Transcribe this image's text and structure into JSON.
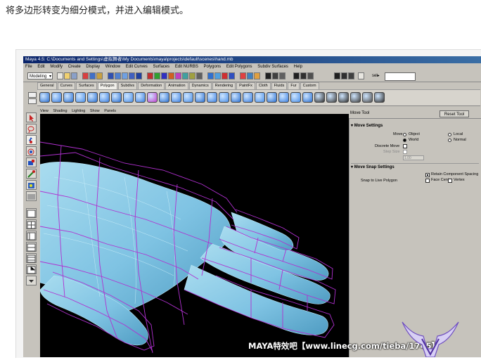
{
  "caption": "将多边形转变为细分模式，并进入编辑模式。",
  "window": {
    "title": "Maya 4.5: C:\\Documents and Settings\\虚拟舞者\\My Documents\\maya\\projects\\default\\scenes\\hand.mb"
  },
  "menubar": [
    "File",
    "Edit",
    "Modify",
    "Create",
    "Display",
    "Window",
    "Edit Curves",
    "Surfaces",
    "Edit NURBS",
    "Polygons",
    "Edit Polygons",
    "Subdiv Surfaces",
    "Help"
  ],
  "statusline": {
    "mode": "Modeling",
    "sel_label": "sel▸",
    "sel_value": ""
  },
  "shelf_tabs": {
    "items": [
      "General",
      "Curves",
      "Surfaces",
      "Polygon",
      "Subdivs",
      "Deformation",
      "Animation",
      "Dynamics",
      "Rendering",
      "PaintFx",
      "Cloth",
      "Fluids",
      "Fur",
      "Custom"
    ],
    "active_index": 3
  },
  "panel_menu": [
    "View",
    "Shading",
    "Lighting",
    "Show",
    "Panels"
  ],
  "tool_settings": {
    "title": "Move Tool",
    "reset_button": "Reset Tool",
    "move_settings": {
      "header": "Move Settings",
      "move_label": "Move",
      "options": [
        "Object",
        "Local",
        "World",
        "Normal"
      ],
      "selected": "World",
      "discrete_move_label": "Discrete Move",
      "step_size_label": "Step Size",
      "step_size_value": "1.00"
    },
    "snap_settings": {
      "header": "Move Snap Settings",
      "retain_label": "Retain Component Spacing",
      "retain_checked": true,
      "snap_live_label": "Snap to Live Polygon",
      "face_center_label": "Face Center",
      "vertex_label": "Vertex"
    }
  },
  "watermark": "MAYA特效吧【www.linecg.com/tieba/1745】",
  "colors": {
    "accent_title": "#0a246a",
    "viewport_bg": "#000000",
    "mesh": "#7fc3e3",
    "cage": "#b030d0"
  }
}
